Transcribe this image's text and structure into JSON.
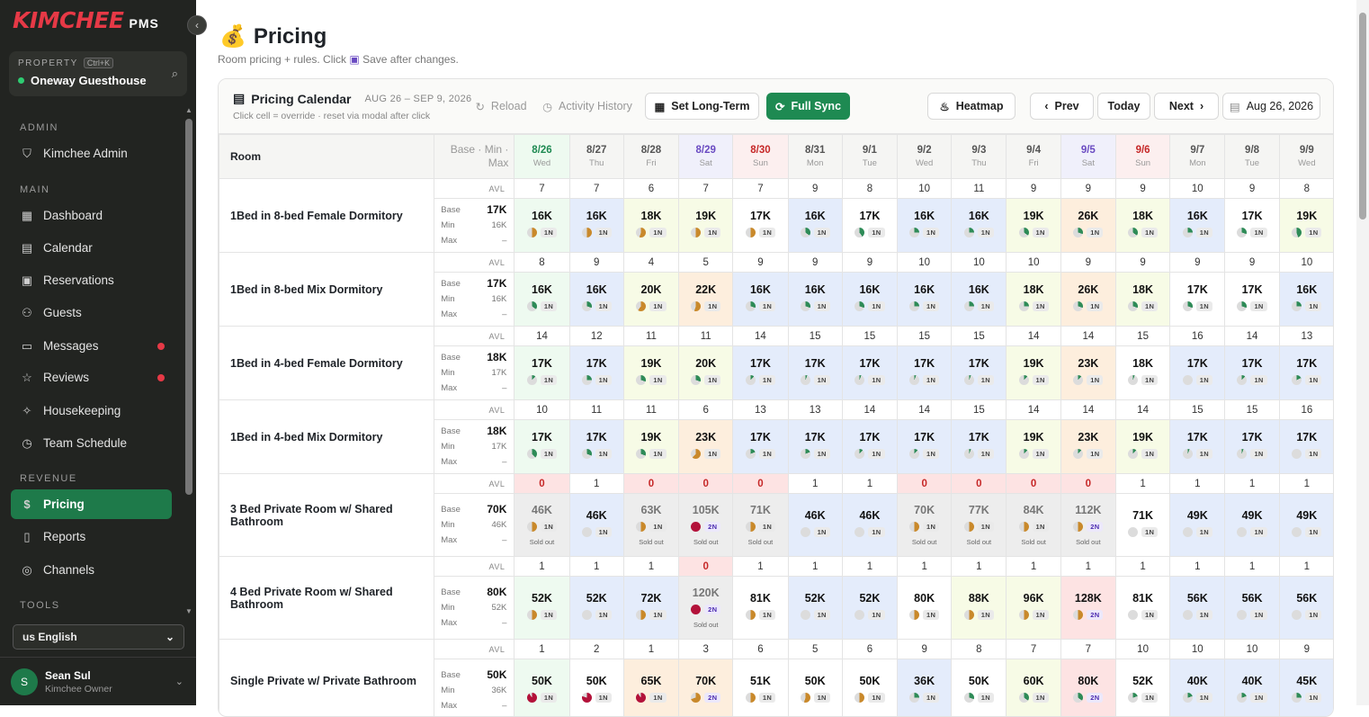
{
  "brand": {
    "logo": "KIMCHEE",
    "suffix": "PMS"
  },
  "property": {
    "label": "PROPERTY",
    "shortcut": "Ctrl+K",
    "name": "Oneway Guesthouse"
  },
  "sidebar": {
    "sections": [
      {
        "label": "ADMIN"
      },
      {
        "label": "MAIN"
      },
      {
        "label": "REVENUE"
      },
      {
        "label": "TOOLS"
      }
    ],
    "items": [
      {
        "label": "Kimchee Admin",
        "icon": "shield-icon",
        "glyph": "⛉",
        "badge": false
      },
      {
        "label": "Dashboard",
        "icon": "grid-icon",
        "glyph": "▦",
        "badge": false
      },
      {
        "label": "Calendar",
        "icon": "calendar-icon",
        "glyph": "▤",
        "badge": false
      },
      {
        "label": "Reservations",
        "icon": "clipboard-icon",
        "glyph": "▣",
        "badge": false
      },
      {
        "label": "Guests",
        "icon": "users-icon",
        "glyph": "⚇",
        "badge": false
      },
      {
        "label": "Messages",
        "icon": "message-icon",
        "glyph": "▭",
        "badge": true
      },
      {
        "label": "Reviews",
        "icon": "star-icon",
        "glyph": "☆",
        "badge": true
      },
      {
        "label": "Housekeeping",
        "icon": "sparkle-icon",
        "glyph": "✧",
        "badge": false
      },
      {
        "label": "Team Schedule",
        "icon": "schedule-icon",
        "glyph": "◷",
        "badge": false
      },
      {
        "label": "Pricing",
        "icon": "dollar-icon",
        "glyph": "$",
        "badge": false,
        "active": true
      },
      {
        "label": "Reports",
        "icon": "file-icon",
        "glyph": "▯",
        "badge": false
      },
      {
        "label": "Channels",
        "icon": "radio-icon",
        "glyph": "◎",
        "badge": false
      }
    ],
    "language": "us English",
    "user": {
      "initial": "S",
      "name": "Sean Sul",
      "role": "Kimchee Owner"
    }
  },
  "page": {
    "title": "Pricing",
    "subtitle_pre": "Room pricing + rules. Click",
    "subtitle_post": "Save after changes."
  },
  "toolbar": {
    "title": "Pricing Calendar",
    "range": "AUG 26 – SEP 9, 2026",
    "note": "Click cell = override · reset via modal after click",
    "reload": "Reload",
    "activity": "Activity History",
    "set_long_term": "Set Long-Term",
    "full_sync": "Full Sync",
    "heatmap": "Heatmap",
    "prev": "Prev",
    "today": "Today",
    "next": "Next",
    "date": "Aug 26, 2026"
  },
  "table": {
    "room_header": "Room",
    "bmm_header_line1": "Base · Min ·",
    "bmm_header_line2": "Max",
    "avl_label": "AVL",
    "base_label": "Base",
    "min_label": "Min",
    "max_label": "Max",
    "sold_out_label": "Sold out",
    "days": [
      {
        "date": "8/26",
        "weekday": "Wed",
        "kind": "today"
      },
      {
        "date": "8/27",
        "weekday": "Thu",
        "kind": ""
      },
      {
        "date": "8/28",
        "weekday": "Fri",
        "kind": ""
      },
      {
        "date": "8/29",
        "weekday": "Sat",
        "kind": "sat"
      },
      {
        "date": "8/30",
        "weekday": "Sun",
        "kind": "sun"
      },
      {
        "date": "8/31",
        "weekday": "Mon",
        "kind": ""
      },
      {
        "date": "9/1",
        "weekday": "Tue",
        "kind": ""
      },
      {
        "date": "9/2",
        "weekday": "Wed",
        "kind": ""
      },
      {
        "date": "9/3",
        "weekday": "Thu",
        "kind": ""
      },
      {
        "date": "9/4",
        "weekday": "Fri",
        "kind": ""
      },
      {
        "date": "9/5",
        "weekday": "Sat",
        "kind": "sat"
      },
      {
        "date": "9/6",
        "weekday": "Sun",
        "kind": "sun"
      },
      {
        "date": "9/7",
        "weekday": "Mon",
        "kind": ""
      },
      {
        "date": "9/8",
        "weekday": "Tue",
        "kind": ""
      },
      {
        "date": "9/9",
        "weekday": "Wed",
        "kind": ""
      }
    ],
    "rooms": [
      {
        "name": "1Bed in 8-bed Female Dormitory",
        "base": "17K",
        "min": "16K",
        "max": "–",
        "avl": [
          "7",
          "7",
          "6",
          "7",
          "7",
          "9",
          "8",
          "10",
          "11",
          "9",
          "9",
          "9",
          "10",
          "9",
          "8"
        ],
        "prices": [
          "16K",
          "16K",
          "18K",
          "19K",
          "17K",
          "16K",
          "17K",
          "16K",
          "16K",
          "19K",
          "26K",
          "18K",
          "16K",
          "17K",
          "19K"
        ],
        "nights": [
          "1N",
          "1N",
          "1N",
          "1N",
          "1N",
          "1N",
          "1N",
          "1N",
          "1N",
          "1N",
          "1N",
          "1N",
          "1N",
          "1N",
          "1N"
        ],
        "tone": [
          "g",
          "b",
          "y",
          "y",
          "w",
          "b",
          "w",
          "b",
          "b",
          "y",
          "o",
          "y",
          "b",
          "w",
          "y"
        ],
        "occ": [
          0.5,
          0.5,
          0.55,
          0.5,
          0.5,
          0.35,
          0.4,
          0.25,
          0.25,
          0.35,
          0.3,
          0.35,
          0.25,
          0.3,
          0.45
        ],
        "occ_color": [
          "#c9892b",
          "#c9892b",
          "#c9892b",
          "#c9892b",
          "#c9892b",
          "#2e8b57",
          "#2e8b57",
          "#2e8b57",
          "#2e8b57",
          "#2e8b57",
          "#2e8b57",
          "#2e8b57",
          "#2e8b57",
          "#2e8b57",
          "#2e8b57"
        ],
        "sold": [
          false,
          false,
          false,
          false,
          false,
          false,
          false,
          false,
          false,
          false,
          false,
          false,
          false,
          false,
          false
        ]
      },
      {
        "name": "1Bed in 8-bed Mix Dormitory",
        "base": "17K",
        "min": "16K",
        "max": "–",
        "avl": [
          "8",
          "9",
          "4",
          "5",
          "9",
          "9",
          "9",
          "10",
          "10",
          "10",
          "9",
          "9",
          "9",
          "9",
          "10"
        ],
        "prices": [
          "16K",
          "16K",
          "20K",
          "22K",
          "16K",
          "16K",
          "16K",
          "16K",
          "16K",
          "18K",
          "26K",
          "18K",
          "17K",
          "17K",
          "16K"
        ],
        "nights": [
          "1N",
          "1N",
          "1N",
          "1N",
          "1N",
          "1N",
          "1N",
          "1N",
          "1N",
          "1N",
          "1N",
          "1N",
          "1N",
          "1N",
          "1N"
        ],
        "tone": [
          "g",
          "b",
          "y",
          "o",
          "b",
          "b",
          "b",
          "b",
          "b",
          "y",
          "o",
          "y",
          "w",
          "w",
          "b"
        ],
        "occ": [
          0.35,
          0.3,
          0.6,
          0.55,
          0.3,
          0.3,
          0.3,
          0.25,
          0.25,
          0.25,
          0.3,
          0.3,
          0.3,
          0.3,
          0.25
        ],
        "occ_color": [
          "#2e8b57",
          "#2e8b57",
          "#c9892b",
          "#c9892b",
          "#2e8b57",
          "#2e8b57",
          "#2e8b57",
          "#2e8b57",
          "#2e8b57",
          "#2e8b57",
          "#2e8b57",
          "#2e8b57",
          "#2e8b57",
          "#2e8b57",
          "#2e8b57"
        ],
        "sold": [
          false,
          false,
          false,
          false,
          false,
          false,
          false,
          false,
          false,
          false,
          false,
          false,
          false,
          false,
          false
        ]
      },
      {
        "name": "1Bed in 4-bed Female Dormitory",
        "base": "18K",
        "min": "17K",
        "max": "–",
        "avl": [
          "14",
          "12",
          "11",
          "11",
          "14",
          "15",
          "15",
          "15",
          "15",
          "14",
          "14",
          "15",
          "16",
          "14",
          "13"
        ],
        "prices": [
          "17K",
          "17K",
          "19K",
          "20K",
          "17K",
          "17K",
          "17K",
          "17K",
          "17K",
          "19K",
          "23K",
          "18K",
          "17K",
          "17K",
          "17K"
        ],
        "nights": [
          "1N",
          "1N",
          "1N",
          "1N",
          "1N",
          "1N",
          "1N",
          "1N",
          "1N",
          "1N",
          "1N",
          "1N",
          "1N",
          "1N",
          "1N"
        ],
        "tone": [
          "g",
          "b",
          "y",
          "y",
          "b",
          "b",
          "b",
          "b",
          "b",
          "y",
          "o",
          "w",
          "b",
          "b",
          "b"
        ],
        "occ": [
          0.12,
          0.25,
          0.3,
          0.3,
          0.12,
          0.06,
          0.06,
          0.06,
          0.06,
          0.12,
          0.12,
          0.06,
          0,
          0.12,
          0.18
        ],
        "occ_color": [
          "#2e8b57",
          "#2e8b57",
          "#2e8b57",
          "#2e8b57",
          "#2e8b57",
          "#2e8b57",
          "#2e8b57",
          "#2e8b57",
          "#2e8b57",
          "#2e8b57",
          "#2e8b57",
          "#2e8b57",
          "#2e8b57",
          "#2e8b57",
          "#2e8b57"
        ],
        "sold": [
          false,
          false,
          false,
          false,
          false,
          false,
          false,
          false,
          false,
          false,
          false,
          false,
          false,
          false,
          false
        ]
      },
      {
        "name": "1Bed in 4-bed Mix Dormitory",
        "base": "18K",
        "min": "17K",
        "max": "–",
        "avl": [
          "10",
          "11",
          "11",
          "6",
          "13",
          "13",
          "14",
          "14",
          "15",
          "14",
          "14",
          "14",
          "15",
          "15",
          "16"
        ],
        "prices": [
          "17K",
          "17K",
          "19K",
          "23K",
          "17K",
          "17K",
          "17K",
          "17K",
          "17K",
          "19K",
          "23K",
          "19K",
          "17K",
          "17K",
          "17K"
        ],
        "nights": [
          "1N",
          "1N",
          "1N",
          "1N",
          "1N",
          "1N",
          "1N",
          "1N",
          "1N",
          "1N",
          "1N",
          "1N",
          "1N",
          "1N",
          "1N"
        ],
        "tone": [
          "g",
          "b",
          "y",
          "o",
          "b",
          "b",
          "b",
          "b",
          "b",
          "y",
          "o",
          "y",
          "b",
          "b",
          "b"
        ],
        "occ": [
          0.38,
          0.31,
          0.31,
          0.62,
          0.19,
          0.19,
          0.12,
          0.12,
          0.06,
          0.12,
          0.12,
          0.12,
          0.06,
          0.06,
          0
        ],
        "occ_color": [
          "#2e8b57",
          "#2e8b57",
          "#2e8b57",
          "#c9892b",
          "#2e8b57",
          "#2e8b57",
          "#2e8b57",
          "#2e8b57",
          "#2e8b57",
          "#2e8b57",
          "#2e8b57",
          "#2e8b57",
          "#2e8b57",
          "#2e8b57",
          "#2e8b57"
        ],
        "sold": [
          false,
          false,
          false,
          false,
          false,
          false,
          false,
          false,
          false,
          false,
          false,
          false,
          false,
          false,
          false
        ]
      },
      {
        "name": "3 Bed Private Room w/ Shared Bathroom",
        "base": "70K",
        "min": "46K",
        "max": "–",
        "avl": [
          "0",
          "1",
          "0",
          "0",
          "0",
          "1",
          "1",
          "0",
          "0",
          "0",
          "0",
          "1",
          "1",
          "1",
          "1"
        ],
        "prices": [
          "46K",
          "46K",
          "63K",
          "105K",
          "71K",
          "46K",
          "46K",
          "70K",
          "77K",
          "84K",
          "112K",
          "71K",
          "49K",
          "49K",
          "49K"
        ],
        "nights": [
          "1N",
          "1N",
          "1N",
          "2N",
          "1N",
          "1N",
          "1N",
          "1N",
          "1N",
          "1N",
          "2N",
          "1N",
          "1N",
          "1N",
          "1N"
        ],
        "tone": [
          "s",
          "b",
          "s",
          "s",
          "s",
          "b",
          "b",
          "s",
          "s",
          "s",
          "s",
          "w",
          "b",
          "b",
          "b"
        ],
        "occ": [
          0.5,
          0,
          0.5,
          1,
          0.5,
          0,
          0,
          0.5,
          0.5,
          0.5,
          0.5,
          0,
          0,
          0,
          0
        ],
        "occ_color": [
          "#c9892b",
          "#c9892b",
          "#c9892b",
          "#b3123a",
          "#c9892b",
          "#c9892b",
          "#c9892b",
          "#c9892b",
          "#c9892b",
          "#c9892b",
          "#c9892b",
          "#c9892b",
          "#c9892b",
          "#c9892b",
          "#c9892b"
        ],
        "sold": [
          true,
          false,
          true,
          true,
          true,
          false,
          false,
          true,
          true,
          true,
          true,
          false,
          false,
          false,
          false
        ]
      },
      {
        "name": "4 Bed Private Room w/ Shared Bathroom",
        "base": "80K",
        "min": "52K",
        "max": "–",
        "avl": [
          "1",
          "1",
          "1",
          "0",
          "1",
          "1",
          "1",
          "1",
          "1",
          "1",
          "1",
          "1",
          "1",
          "1",
          "1"
        ],
        "prices": [
          "52K",
          "52K",
          "72K",
          "120K",
          "81K",
          "52K",
          "52K",
          "80K",
          "88K",
          "96K",
          "128K",
          "81K",
          "56K",
          "56K",
          "56K"
        ],
        "nights": [
          "1N",
          "1N",
          "1N",
          "2N",
          "1N",
          "1N",
          "1N",
          "1N",
          "1N",
          "1N",
          "2N",
          "1N",
          "1N",
          "1N",
          "1N"
        ],
        "tone": [
          "g",
          "b",
          "b",
          "s",
          "w",
          "b",
          "b",
          "w",
          "y",
          "y",
          "r",
          "w",
          "b",
          "b",
          "b"
        ],
        "occ": [
          0.5,
          0,
          0.5,
          1,
          0.5,
          0,
          0,
          0.5,
          0.5,
          0.5,
          0.5,
          0,
          0,
          0,
          0
        ],
        "occ_color": [
          "#c9892b",
          "#c9892b",
          "#c9892b",
          "#b3123a",
          "#c9892b",
          "#c9892b",
          "#c9892b",
          "#c9892b",
          "#c9892b",
          "#c9892b",
          "#c9892b",
          "#c9892b",
          "#c9892b",
          "#c9892b",
          "#c9892b"
        ],
        "sold": [
          false,
          false,
          false,
          true,
          false,
          false,
          false,
          false,
          false,
          false,
          false,
          false,
          false,
          false,
          false
        ]
      },
      {
        "name": "Single Private w/ Private Bathroom",
        "base": "50K",
        "min": "36K",
        "max": "–",
        "avl": [
          "1",
          "2",
          "1",
          "3",
          "6",
          "5",
          "6",
          "9",
          "8",
          "7",
          "7",
          "10",
          "10",
          "10",
          "9"
        ],
        "prices": [
          "50K",
          "50K",
          "65K",
          "70K",
          "51K",
          "50K",
          "50K",
          "36K",
          "50K",
          "60K",
          "80K",
          "52K",
          "40K",
          "40K",
          "45K"
        ],
        "nights": [
          "1N",
          "1N",
          "1N",
          "2N",
          "1N",
          "1N",
          "1N",
          "1N",
          "1N",
          "1N",
          "2N",
          "1N",
          "1N",
          "1N",
          "1N"
        ],
        "tone": [
          "g",
          "w",
          "o",
          "o",
          "w",
          "w",
          "w",
          "b",
          "w",
          "y",
          "r",
          "w",
          "b",
          "b",
          "b"
        ],
        "occ": [
          0.9,
          0.8,
          0.9,
          0.7,
          0.5,
          0.55,
          0.5,
          0.25,
          0.3,
          0.35,
          0.35,
          0.2,
          0.2,
          0.2,
          0.25
        ],
        "occ_color": [
          "#b3123a",
          "#b3123a",
          "#b3123a",
          "#c9892b",
          "#c9892b",
          "#c9892b",
          "#c9892b",
          "#2e8b57",
          "#2e8b57",
          "#2e8b57",
          "#2e8b57",
          "#2e8b57",
          "#2e8b57",
          "#2e8b57",
          "#2e8b57"
        ],
        "sold": [
          false,
          false,
          false,
          false,
          false,
          false,
          false,
          false,
          false,
          false,
          false,
          false,
          false,
          false,
          false
        ]
      }
    ]
  },
  "colors": {
    "accent": "#1e8a52",
    "brand": "#e63946",
    "tone_g": "#eefaf0",
    "tone_b": "#e4ecfb",
    "tone_y": "#f7fbe6",
    "tone_o": "#fdeedd",
    "tone_w": "#ffffff",
    "tone_s": "#ededed",
    "tone_r": "#fde3e3"
  }
}
